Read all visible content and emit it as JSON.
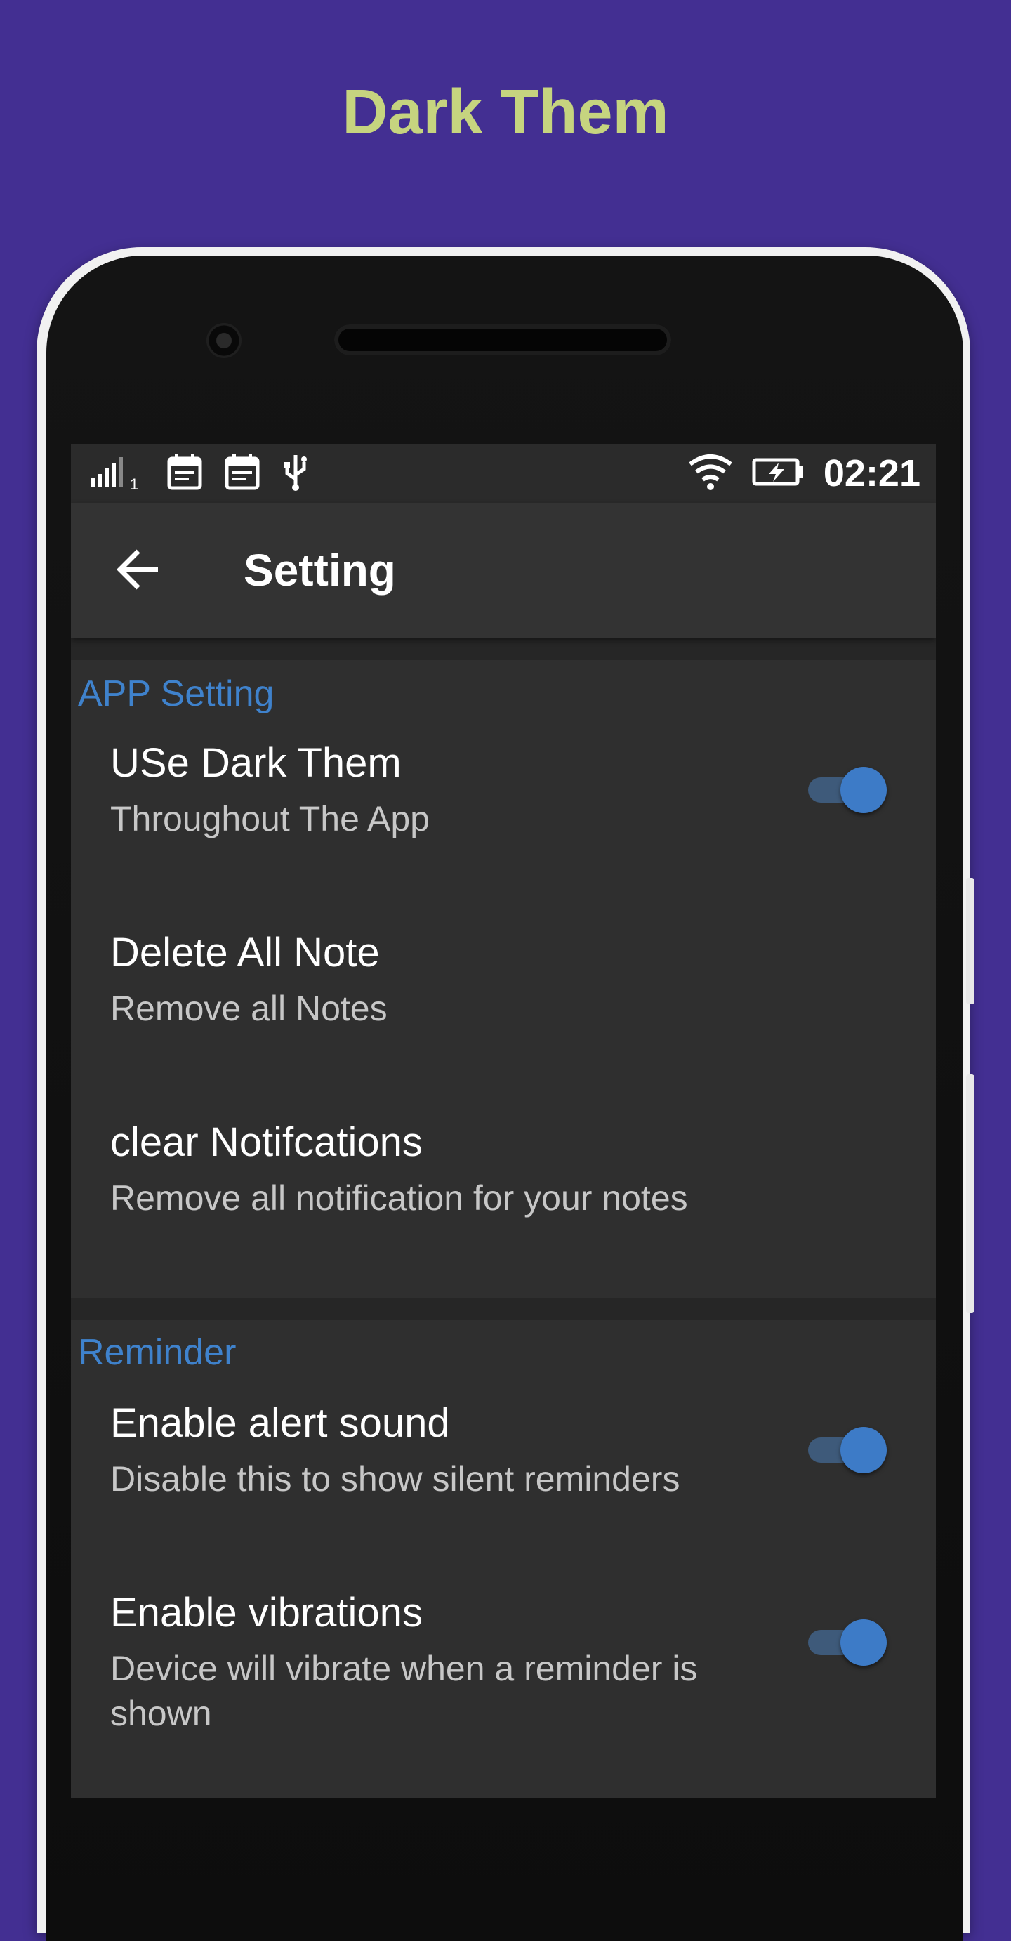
{
  "headline": "Dark Them",
  "status_bar": {
    "signal_sub": "1",
    "time": "02:21",
    "icons": [
      "signal-icon",
      "calendar-icon",
      "calendar-icon",
      "usb-icon",
      "wifi-icon",
      "battery-charging-icon"
    ]
  },
  "app_bar": {
    "back_icon": "arrow-back-icon",
    "title": "Setting"
  },
  "sections": {
    "app": {
      "header": "APP Setting",
      "items": [
        {
          "title": "USe Dark Them",
          "summary": "Throughout The App",
          "switch_on": true
        },
        {
          "title": "Delete All Note",
          "summary": "Remove all Notes"
        },
        {
          "title": "clear Notifcations",
          "summary": "Remove all notification for your notes"
        }
      ]
    },
    "reminder": {
      "header": "Reminder",
      "items": [
        {
          "title": "Enable alert sound",
          "summary": "Disable this to show silent reminders",
          "switch_on": true
        },
        {
          "title": "Enable vibrations",
          "summary": "Device will vibrate when a reminder is shown",
          "switch_on": true
        }
      ]
    }
  },
  "colors": {
    "background": "#432f92",
    "headline": "#c6d47f",
    "accent": "#3d7bc7",
    "section_header": "#3f82cc",
    "screen_bg": "#2f2f2f"
  }
}
